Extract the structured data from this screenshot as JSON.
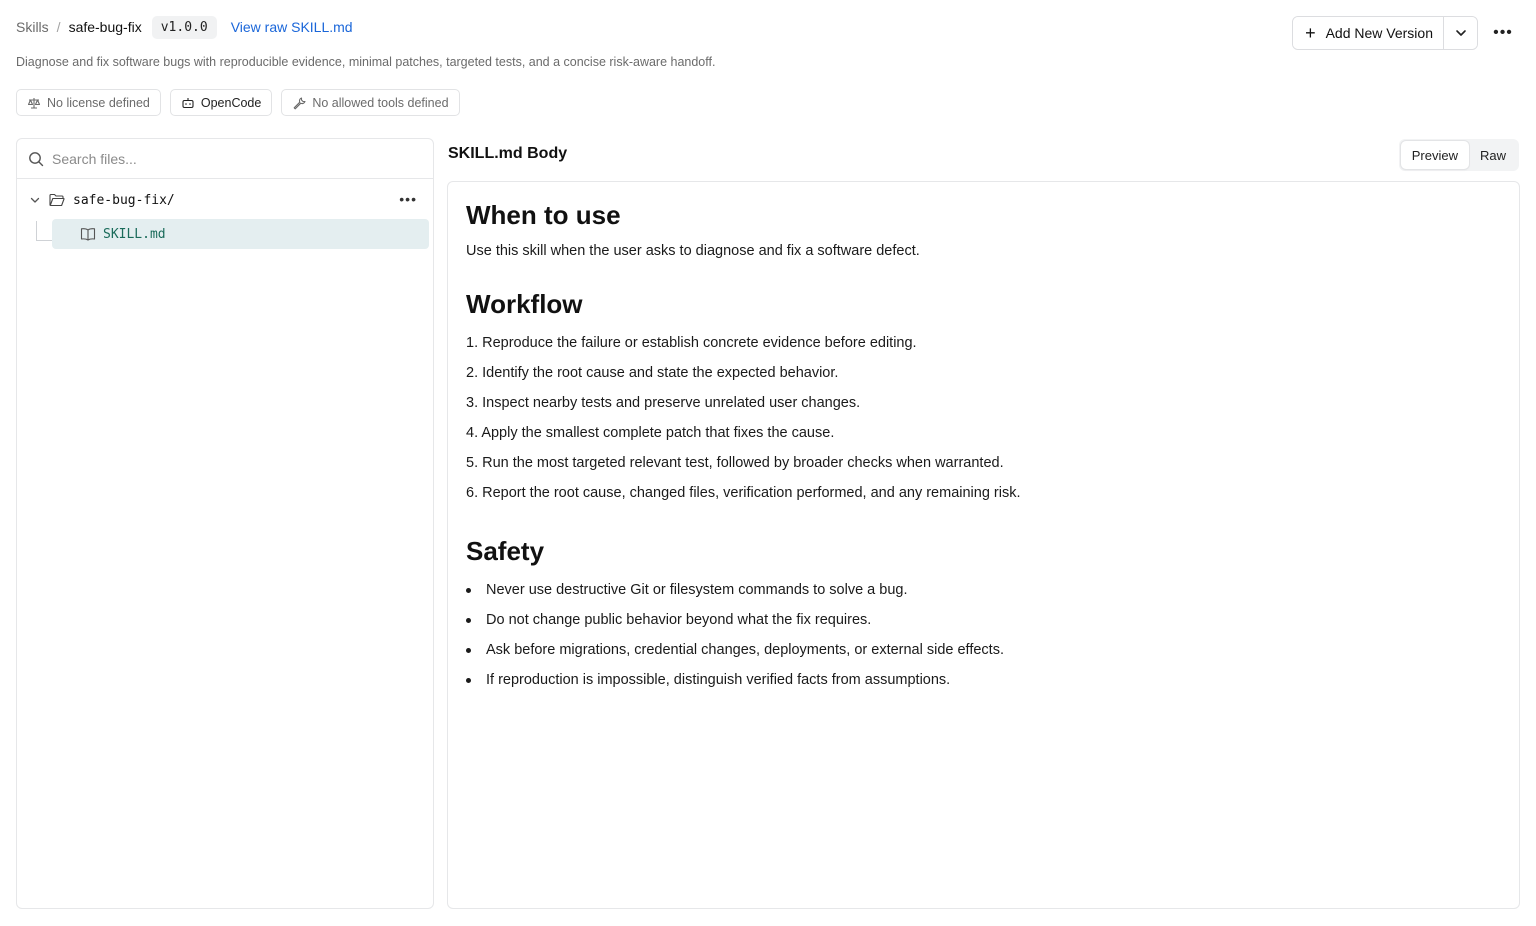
{
  "breadcrumb": {
    "root": "Skills",
    "separator": "/",
    "current": "safe-bug-fix",
    "version": "v1.0.0",
    "raw_link": "View raw SKILL.md"
  },
  "actions": {
    "add_version_label": "Add New Version",
    "more_label": "•••"
  },
  "description": "Diagnose and fix software bugs with reproducible evidence, minimal patches, targeted tests, and a concise risk-aware handoff.",
  "chips": {
    "license": "No license defined",
    "agent": "OpenCode",
    "tools": "No allowed tools defined"
  },
  "file_panel": {
    "search_placeholder": "Search files...",
    "folder_name": "safe-bug-fix/",
    "folder_more": "•••",
    "file_name": "SKILL.md"
  },
  "body": {
    "title": "SKILL.md Body",
    "toggle_preview": "Preview",
    "toggle_raw": "Raw",
    "when_heading": "When to use",
    "when_text": "Use this skill when the user asks to diagnose and fix a software defect.",
    "workflow_heading": "Workflow",
    "workflow_steps": [
      "1. Reproduce the failure or establish concrete evidence before editing.",
      "2. Identify the root cause and state the expected behavior.",
      "3. Inspect nearby tests and preserve unrelated user changes.",
      "4. Apply the smallest complete patch that fixes the cause.",
      "5. Run the most targeted relevant test, followed by broader checks when warranted.",
      "6. Report the root cause, changed files, verification performed, and any remaining risk."
    ],
    "safety_heading": "Safety",
    "safety_items": [
      "Never use destructive Git or filesystem commands to solve a bug.",
      "Do not change public behavior beyond what the fix requires.",
      "Ask before migrations, credential changes, deployments, or external side effects.",
      "If reproduction is impossible, distinguish verified facts from assumptions."
    ]
  },
  "colors": {
    "link": "#1a66d9",
    "selected_row": "#e4eef0",
    "file_name": "#1a6b5a"
  }
}
